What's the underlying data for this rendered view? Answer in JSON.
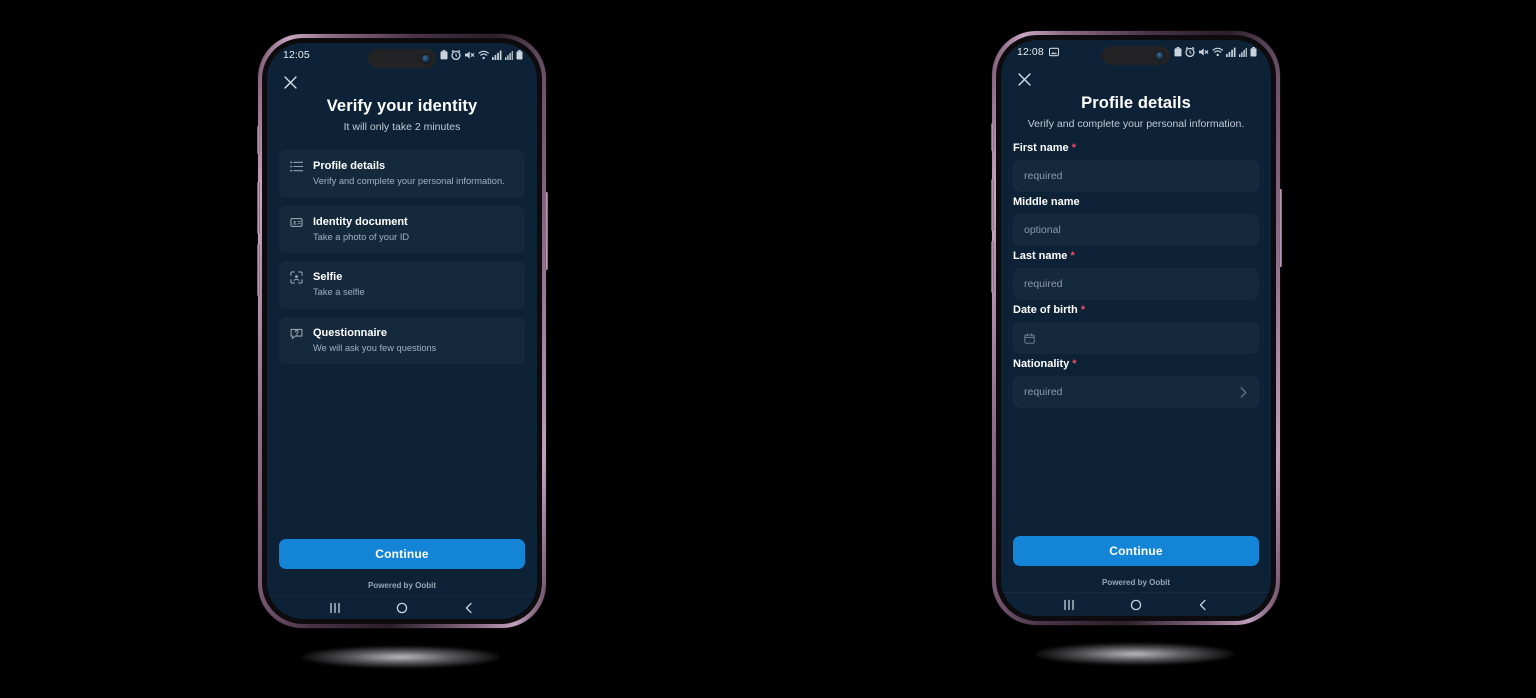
{
  "canvas": {
    "background": "#000000"
  },
  "theme": {
    "screen_bg": "#0d2236",
    "card_bg": "#15293d",
    "accent": "#1484d6",
    "required_mark": "#ef4f63",
    "title_color": "#ffffff",
    "muted_text": "#9fb0c0"
  },
  "phones": [
    {
      "id": "phone-left",
      "status_bar": {
        "time": "12:05",
        "left_icons": [],
        "right_icons": [
          "battery-saver-icon",
          "alarm-icon",
          "mute-icon",
          "wifi-icon",
          "signal-icon",
          "signal-secondary-icon",
          "battery-icon"
        ]
      },
      "screen": {
        "close_label": "✕",
        "title": "Verify your identity",
        "subtitle": "It will only take 2 minutes",
        "steps": [
          {
            "icon": "list-icon",
            "title": "Profile details",
            "desc": "Verify and complete your personal information."
          },
          {
            "icon": "id-card-icon",
            "title": "Identity document",
            "desc": "Take a photo of your ID"
          },
          {
            "icon": "face-scan-icon",
            "title": "Selfie",
            "desc": "Take a selfie"
          },
          {
            "icon": "question-bubble-icon",
            "title": "Questionnaire",
            "desc": "We will ask you few questions"
          }
        ],
        "cta_label": "Continue",
        "powered_by": "Powered by Oobit"
      },
      "nav_bar": {
        "recents": "recents-icon",
        "home": "home-icon",
        "back": "back-icon"
      }
    },
    {
      "id": "phone-right",
      "status_bar": {
        "time": "12:08",
        "left_icons": [
          "screenshot-icon"
        ],
        "right_icons": [
          "battery-saver-icon",
          "alarm-icon",
          "mute-icon",
          "wifi-icon",
          "signal-icon",
          "signal-secondary-icon",
          "battery-icon"
        ]
      },
      "screen": {
        "close_label": "✕",
        "title": "Profile details",
        "subtitle": "Verify and complete your personal information.",
        "fields": [
          {
            "label": "First name",
            "required": true,
            "placeholder": "required",
            "value": "",
            "icon": null,
            "trailing_icon": null
          },
          {
            "label": "Middle name",
            "required": false,
            "placeholder": "optional",
            "value": "",
            "icon": null,
            "trailing_icon": null
          },
          {
            "label": "Last name",
            "required": true,
            "placeholder": "required",
            "value": "",
            "icon": null,
            "trailing_icon": null
          },
          {
            "label": "Date of birth",
            "required": true,
            "placeholder": "",
            "value": "",
            "icon": "calendar-icon",
            "trailing_icon": null
          },
          {
            "label": "Nationality",
            "required": true,
            "placeholder": "required",
            "value": "",
            "icon": null,
            "trailing_icon": "chevron-right-icon"
          }
        ],
        "cta_label": "Continue",
        "powered_by": "Powered by Oobit"
      },
      "nav_bar": {
        "recents": "recents-icon",
        "home": "home-icon",
        "back": "back-icon"
      }
    }
  ]
}
